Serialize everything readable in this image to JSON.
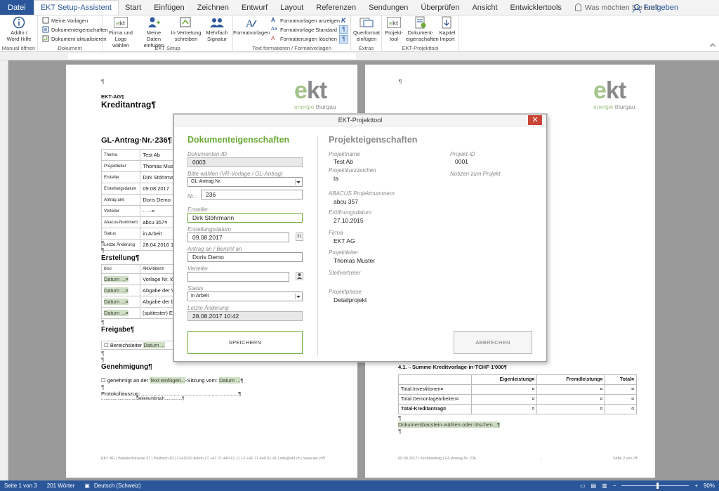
{
  "ribbon_tabs": {
    "file": "Datei",
    "active": "EKT Setup-Assistent",
    "tabs": [
      "Start",
      "Einfügen",
      "Zeichnen",
      "Entwurf",
      "Layout",
      "Referenzen",
      "Sendungen",
      "Überprüfen",
      "Ansicht",
      "Entwicklertools"
    ],
    "tell_me": "Was möchten Sie tun?",
    "share": "Freigeben"
  },
  "ribbon": {
    "g1": {
      "btn": "AddIn / Word Hilfe",
      "label": "Manual öffnen"
    },
    "g2": {
      "items": [
        "Meine Vorlagen",
        "Dokumenteigenschaften",
        "Dokument aktualisieren"
      ],
      "label": "Dokument"
    },
    "g3": {
      "btns": [
        "Firma und Logo wählen",
        "Meine Daten einfügen",
        "In Vertretung schreiben",
        "Mehrfach Signatur"
      ],
      "label": "EKT Setup"
    },
    "g4": {
      "btn": "Formatvorlagen",
      "items": [
        "Formatvorlagen anzeigen",
        "Formatvorlage Standard",
        "Formatierungen löschen"
      ],
      "label": "Text formatieren / Formatvorlagen"
    },
    "g5": {
      "btn": "Querformat einfügen",
      "label": "Extras"
    },
    "g6": {
      "btns": [
        "Projekt-tool",
        "Dokument-eigenschaften",
        "Kapitel Import"
      ],
      "label": "EKT-Projekttool"
    }
  },
  "page1": {
    "company": "EKT-AG¶",
    "title": "Kreditantrag¶",
    "gl_antrag": "GL-Antrag·Nr.·236¶",
    "table": [
      {
        "k": "Thema",
        "v": "Test Ab"
      },
      {
        "k": "Projektleiter",
        "v": "Thomas Muste"
      },
      {
        "k": "Ersteller",
        "v": "Dirk Stöhrmann"
      },
      {
        "k": "Erstellungsdatum",
        "v": "09.08.2017"
      },
      {
        "k": "Antrag an¤",
        "v": "Doris Demo"
      },
      {
        "k": "Verteiler",
        "v": "·····¤"
      },
      {
        "k": "Abacus-Nummer¤",
        "v": "abcu 357¤"
      },
      {
        "k": "Status",
        "v": "in Arbeit"
      },
      {
        "k": "Letzte Änderung",
        "v": "28.04.2016 18"
      }
    ],
    "erstellung": "Erstellung¶",
    "erst_table": [
      {
        "k": "bis¤",
        "v": "Aktivitäten¤"
      },
      {
        "k": "Datum ...¤",
        "v": "Vorlage Nr. lös"
      },
      {
        "k": "Datum ...¤",
        "v": "Abgabe der Vo"
      },
      {
        "k": "Datum ...¤",
        "v": "Abgabe der be"
      },
      {
        "k": "Datum ...¤",
        "v": "(spätester) Ei"
      }
    ],
    "freigabe": "Freigabe¶",
    "bereichsleiter": "Bereichsleiter",
    "datum": "Datum ...",
    "genehmigung": "Genehmigung¶",
    "genehmigt_pre": "genehmigt an der",
    "text_einfuegen": "Text einfügen...",
    "genehmigt_mid": "-Sitzung vom:",
    "protokoll": "Protokollauszug:",
    "seitenumbruch": "Seitenumbruch",
    "footer": "EKT AG | Bahnhofstrasse 37 | Postfach 82 | CH-9320 Arbon | T +41 71 440 61 11 | F +41 71 440 61 41 | info@ekt.ch | www.ekt.ch¶"
  },
  "logo": {
    "e": "e",
    "kt": "kt",
    "sub_green": "energie",
    "sub_gray": "thurgau"
  },
  "page2": {
    "heading": "4.1.→Summe·Kreditvorlage·in·TCHF·1'000¶",
    "cols": [
      "Eigenleistung¤",
      "Fremdleistung¤",
      "Total¤"
    ],
    "rows": [
      {
        "label": "Total·Investitionen¤",
        "vals": [
          "¤",
          "¤",
          "¤"
        ]
      },
      {
        "label": "Total·Demontagearbeiten¤",
        "vals": [
          "¤",
          "¤",
          "¤"
        ]
      },
      {
        "label": "Total·Kreditantrag¤",
        "vals": [
          "¤",
          "¤",
          "¤"
        ]
      }
    ],
    "baustein": "Dokumentbaustein·wählen·oder·löschen...¶",
    "footer_left": "09.08.2017 | Kreditantrag | GL-Antrag Nr. 236",
    "footer_right": "Seite 2 von 3¶"
  },
  "dialog": {
    "title": "EKT-Projekttool",
    "left_title": "Dokumenteigenschaften",
    "right_title": "Projekteigenschaften",
    "labels": {
      "dokumenten_id": "Dokumenten-ID",
      "vorlage": "Bitte wählen (VR-Vorlage / GL-Antrag)",
      "nr": "Nr.:",
      "ersteller": "Ersteller",
      "erstellungsdatum": "Erstellungsdatum",
      "antrag": "Antrag an / Bericht an",
      "verteiler": "Verteiler",
      "status": "Status",
      "letzte_aenderung": "Letzte Änderung"
    },
    "values": {
      "dokumenten_id": "0003",
      "vorlage": "GL-Antrag Nr.",
      "nr": "236",
      "ersteller": "Dirk Stöhrmann",
      "erstellungsdatum": "09.08.2017",
      "antrag": "Doris Demo",
      "verteiler": "",
      "status": "in Arbeit",
      "letzte_aenderung": "28.08.2017 10:42"
    },
    "calendar_icon_text": "31",
    "project": {
      "projektname_l": "Projektname",
      "projektname": "Test Ab",
      "kurz_l": "Projektkurzzeichen",
      "kurz": "ta",
      "abacus_l": "ABACUS Projektnummern",
      "abacus": "abcu 357",
      "eroeff_l": "Eröffnungsdatum",
      "eroeff": "27.10.2015",
      "firma_l": "Firma",
      "firma": "EKT AG",
      "leiter_l": "Projektleiter",
      "leiter": "Thomas Muster",
      "stellv_l": "Stellvertreter",
      "phase_l": "Projektphase",
      "phase": "Detailprojekt",
      "id_l": "Projekt-ID",
      "id": "0001",
      "notizen_l": "Notizen zum Projekt"
    },
    "save": "SPEICHERN",
    "cancel": "ABBRECHEN"
  },
  "statusbar": {
    "page": "Seite 1 von 3",
    "words": "201 Wörter",
    "lang": "Deutsch (Schweiz)",
    "zoom": "90%"
  },
  "colors": {
    "word_blue": "#2b579a",
    "ekt_green": "#6bab37",
    "logo_green": "#a4c48a",
    "close_red": "#c94434"
  }
}
